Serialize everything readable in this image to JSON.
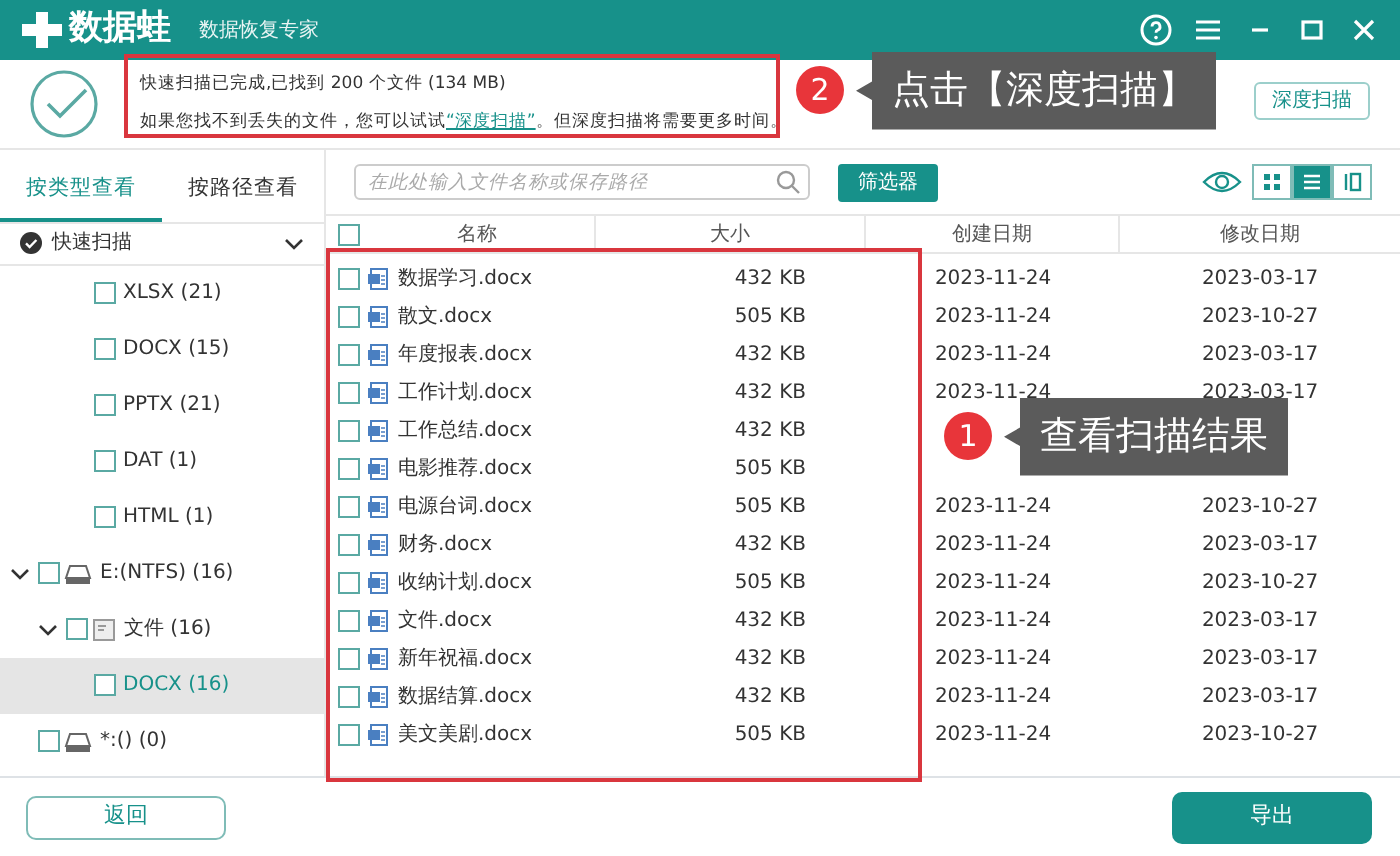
{
  "window": {
    "app_name": "数据蛙",
    "subtitle": "数据恢复专家"
  },
  "scan_summary": {
    "status": "快速扫描已完成,已找到 200 个文件 (134 MB)",
    "hint_before": "如果您找不到丢失的文件，您可以试试",
    "hint_link": "“深度扫描”",
    "hint_after": "。但深度扫描将需要更多时间。",
    "deep_scan_button": "深度扫描"
  },
  "view_tabs": [
    {
      "label": "按类型查看",
      "selected": true
    },
    {
      "label": "按路径查看",
      "selected": false
    }
  ],
  "scan_group": {
    "label": "快速扫描",
    "expanded": true
  },
  "tree": [
    {
      "kind": "type",
      "label": "XLSX (21)",
      "checked": false,
      "selected": false
    },
    {
      "kind": "type",
      "label": "DOCX (15)",
      "checked": false,
      "selected": false
    },
    {
      "kind": "type",
      "label": "PPTX (21)",
      "checked": false,
      "selected": false
    },
    {
      "kind": "type",
      "label": "DAT (1)",
      "checked": false,
      "selected": false
    },
    {
      "kind": "type",
      "label": "HTML (1)",
      "checked": false,
      "selected": false
    },
    {
      "kind": "drive",
      "label": "E:(NTFS) (16)",
      "checked": false,
      "selected": false,
      "expanded": true,
      "children": [
        {
          "kind": "folder",
          "label": "文件 (16)",
          "checked": false,
          "selected": false,
          "expanded": true,
          "children": [
            {
              "kind": "type",
              "label": "DOCX (16)",
              "checked": false,
              "selected": true
            }
          ]
        }
      ]
    },
    {
      "kind": "drive",
      "label": "*:() (0)",
      "checked": false,
      "selected": false
    }
  ],
  "search": {
    "placeholder": "在此处输入文件名称或保存路径"
  },
  "filter_button": "筛选器",
  "view_modes": [
    {
      "kind": "grid",
      "selected": false
    },
    {
      "kind": "list",
      "selected": true
    },
    {
      "kind": "columns",
      "selected": false
    }
  ],
  "table": {
    "columns": [
      "名称",
      "大小",
      "创建日期",
      "修改日期"
    ],
    "header_checked": false,
    "rows": [
      {
        "name": "数据学习.docx",
        "size": "432 KB",
        "created": "2023-11-24",
        "modified": "2023-03-17",
        "checked": false
      },
      {
        "name": "散文.docx",
        "size": "505 KB",
        "created": "2023-11-24",
        "modified": "2023-10-27",
        "checked": false
      },
      {
        "name": "年度报表.docx",
        "size": "432 KB",
        "created": "2023-11-24",
        "modified": "2023-03-17",
        "checked": false
      },
      {
        "name": "工作计划.docx",
        "size": "432 KB",
        "created": "2023-11-24",
        "modified": "2023-03-17",
        "checked": false
      },
      {
        "name": "工作总结.docx",
        "size": "432 KB",
        "checked": false
      },
      {
        "name": "电影推荐.docx",
        "size": "505 KB",
        "checked": false
      },
      {
        "name": "电源台词.docx",
        "size": "505 KB",
        "created": "2023-11-24",
        "modified": "2023-10-27",
        "checked": false
      },
      {
        "name": "财务.docx",
        "size": "432 KB",
        "created": "2023-11-24",
        "modified": "2023-03-17",
        "checked": false
      },
      {
        "name": "收纳计划.docx",
        "size": "505 KB",
        "created": "2023-11-24",
        "modified": "2023-10-27",
        "checked": false
      },
      {
        "name": "文件.docx",
        "size": "432 KB",
        "created": "2023-11-24",
        "modified": "2023-03-17",
        "checked": false
      },
      {
        "name": "新年祝福.docx",
        "size": "432 KB",
        "created": "2023-11-24",
        "modified": "2023-03-17",
        "checked": false
      },
      {
        "name": "数据结算.docx",
        "size": "432 KB",
        "created": "2023-11-24",
        "modified": "2023-03-17",
        "checked": false
      },
      {
        "name": "美文美剧.docx",
        "size": "505 KB",
        "created": "2023-11-24",
        "modified": "2023-10-27",
        "checked": false
      }
    ]
  },
  "buttons": {
    "back": "返回",
    "export": "导出"
  },
  "annotations": [
    {
      "number": "2",
      "text": "点击【深度扫描】"
    },
    {
      "number": "1",
      "text": "查看扫描结果"
    }
  ]
}
